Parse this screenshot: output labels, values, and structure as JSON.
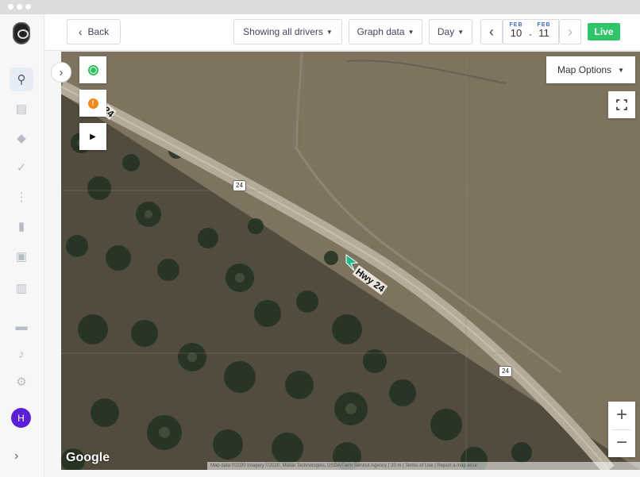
{
  "header": {
    "back_label": "Back",
    "drivers_label": "Showing all drivers",
    "graph_label": "Graph data",
    "period_label": "Day",
    "date_start": {
      "month": "FEB",
      "day": "10"
    },
    "date_end": {
      "month": "FEB",
      "day": "11"
    },
    "date_separator": "-",
    "live_label": "Live"
  },
  "sidebar": {
    "user_initial": "H",
    "icons": [
      "dashboard-map-icon",
      "trips-icon",
      "safety-shield-icon",
      "maintenance-wrench-icon",
      "routes-icon",
      "fuel-icon",
      "documents-icon",
      "reports-icon",
      "messages-icon",
      "alerts-bell-icon",
      "settings-gear-icon"
    ]
  },
  "map": {
    "options_label": "Map Options",
    "road_label": "Hwy 24",
    "route_shield_1": "24",
    "route_shield_2": "24",
    "edge_road_label": "24",
    "brand": "Google",
    "attribution": "Map data ©2020 Imagery ©2020, Maxar Technologies, USDA Farm Service Agency | 20 m | Terms of Use | Report a map error",
    "zoom_in_label": "+",
    "zoom_out_label": "−",
    "status_colors": {
      "active": "#2fbf5d",
      "warning": "#f18a19"
    }
  }
}
